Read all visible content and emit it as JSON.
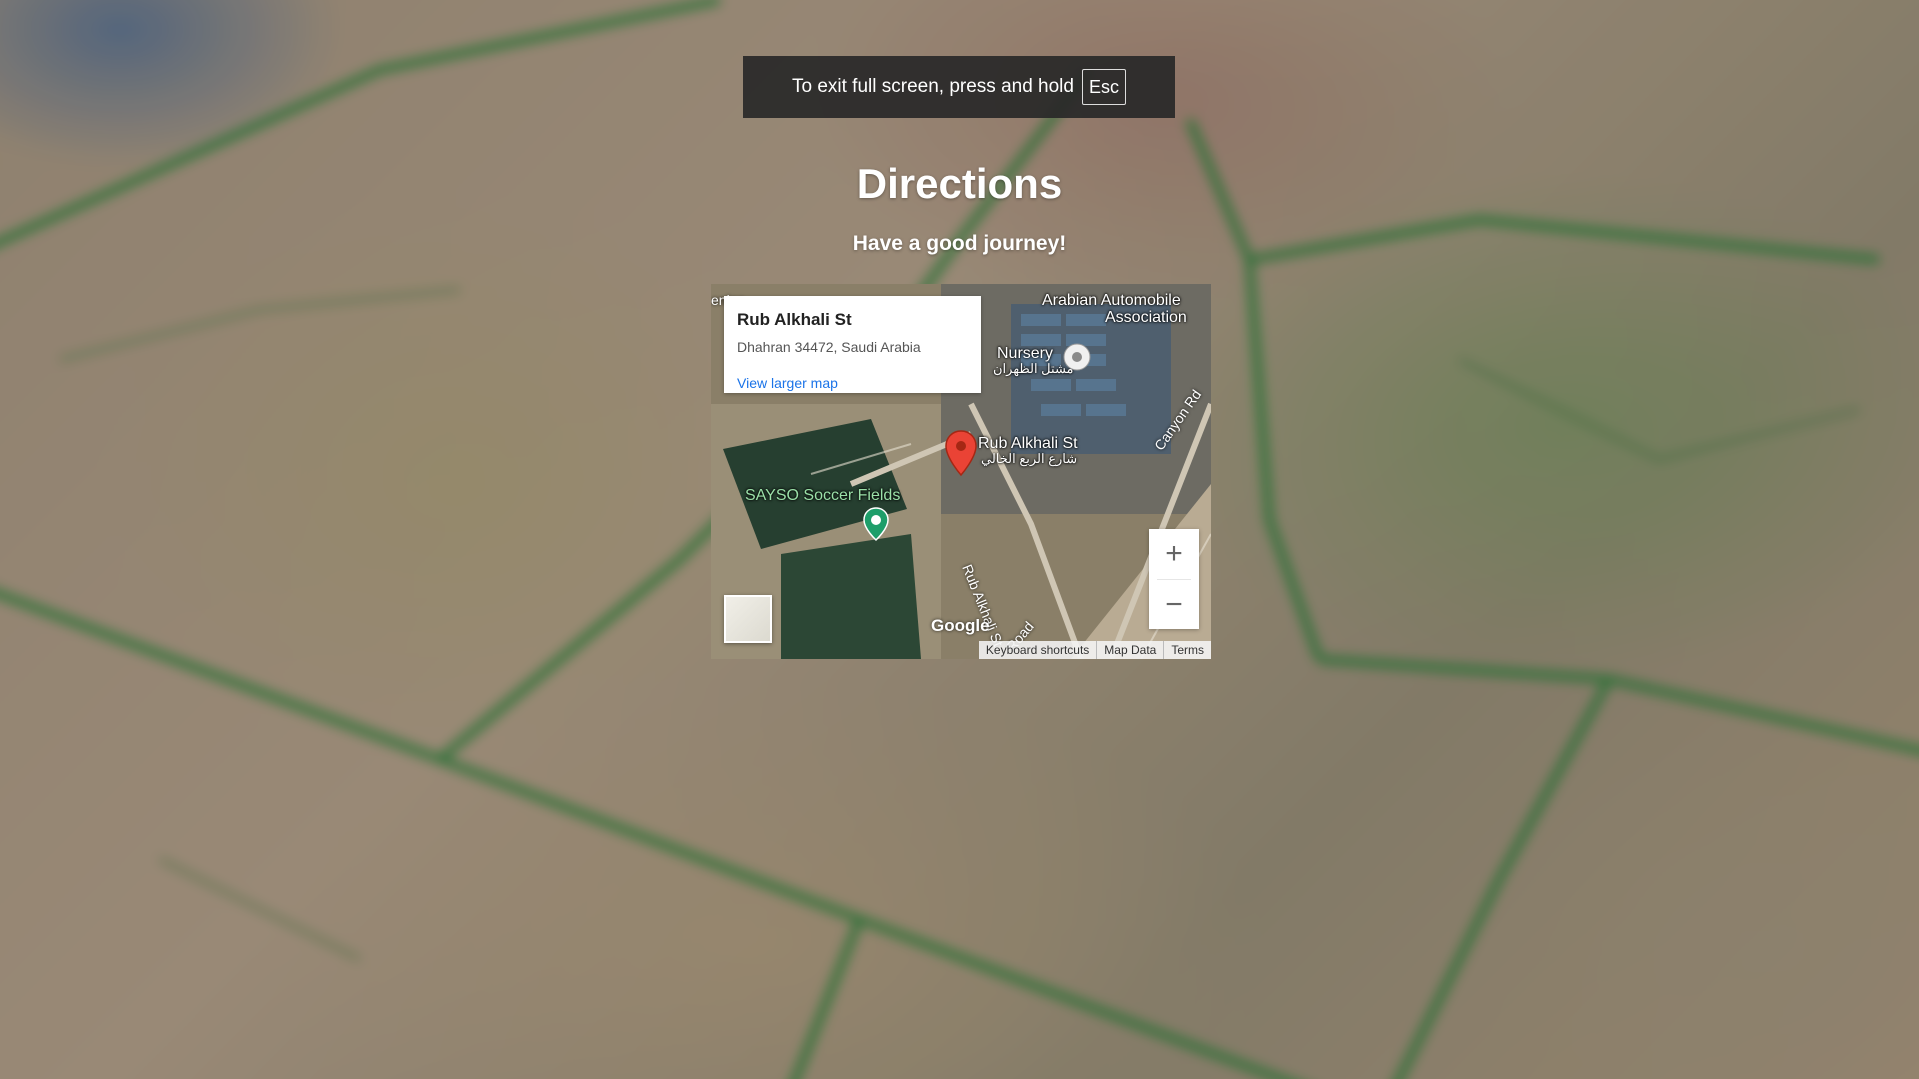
{
  "fullscreen_notice": {
    "text": "To exit full screen, press and hold",
    "key": "Esc"
  },
  "page": {
    "title": "Directions",
    "subtitle": "Have a good journey!"
  },
  "map": {
    "info": {
      "title": "Rub Alkhali St",
      "address": "Dhahran 34472, Saudi Arabia",
      "link": "View larger map"
    },
    "labels": {
      "place_top": "Arabian Automobile",
      "place_top_2": "Association",
      "nursery": "Nursery",
      "nursery_ar": "مشتل الظهران",
      "pin_en": "Rub Alkhali St",
      "pin_ar": "شارع الربع الخالي",
      "soccer": "SAYSO Soccer Fields",
      "road_1": "Rub Alkhali St",
      "road_2": "Canyon Rd",
      "road_3": "Road",
      "road_4": "enins"
    },
    "zoom_in": "+",
    "zoom_out": "−",
    "brand": "Google",
    "attribution": [
      "Keyboard shortcuts",
      "Map Data",
      "Terms"
    ],
    "pin_color": "#ea4335",
    "poi_color": "#1e9e6a"
  }
}
